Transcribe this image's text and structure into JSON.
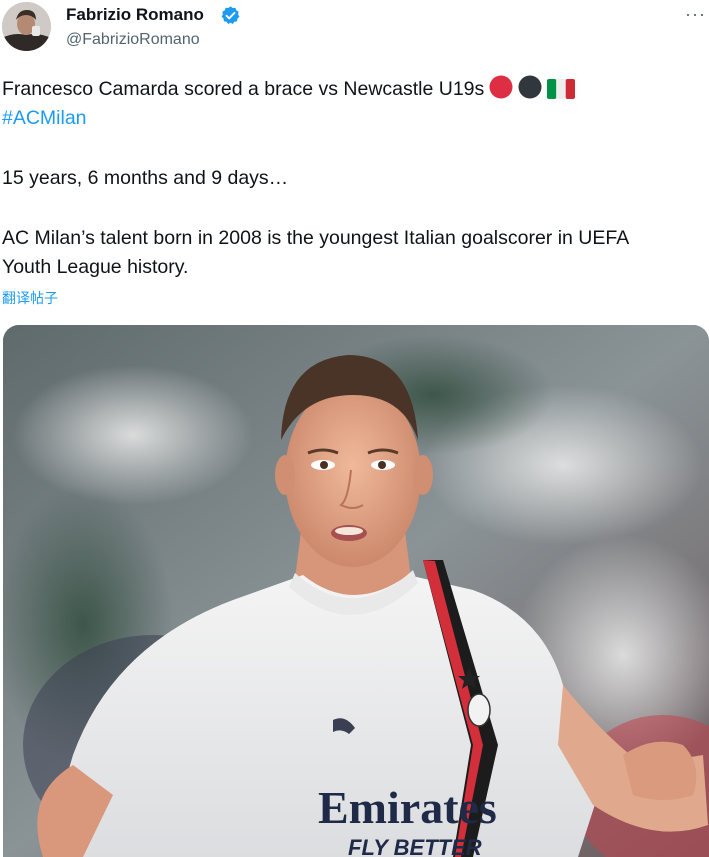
{
  "author": {
    "name": "Fabrizio Romano",
    "handle": "@FabrizioRomano",
    "verified_color": "#1d9bf0"
  },
  "menu": {
    "more_label": "···"
  },
  "tweet": {
    "line1": "Francesco Camarda scored a brace vs Newcastle U19s",
    "hashtag": "#ACMilan",
    "line2": "15 years, 6 months and 9 days…",
    "line3a": "AC Milan’s talent born in 2008 is the youngest Italian goalscorer in UEFA",
    "line3b": "Youth League history.",
    "emojis": [
      "red-circle",
      "black-circle",
      "italy-flag"
    ]
  },
  "translate": {
    "label": "翻译帖子"
  },
  "media": {
    "alt": "Francesco Camarda in white AC Milan away kit",
    "shirt_sponsor": "Emirates",
    "shirt_sponsor_sub": "FLY BETTER"
  }
}
